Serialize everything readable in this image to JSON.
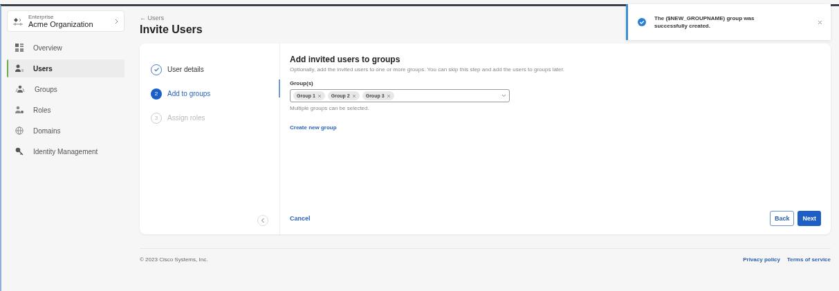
{
  "org": {
    "label": "Enterprise",
    "name": "Acme Organization"
  },
  "sidebar": {
    "items": [
      {
        "label": "Overview",
        "selected": false
      },
      {
        "label": "Users",
        "selected": true
      },
      {
        "label": "Groups",
        "selected": false
      },
      {
        "label": "Roles",
        "selected": false
      },
      {
        "label": "Domains",
        "selected": false
      },
      {
        "label": "Identity Management",
        "selected": false
      }
    ]
  },
  "header": {
    "back": "← Users",
    "title": "Invite Users"
  },
  "steps": [
    {
      "label": "User details",
      "kind": "done"
    },
    {
      "number": "2",
      "label": "Add to groups",
      "kind": "current"
    },
    {
      "number": "3",
      "label": "Assign roles",
      "kind": "pending"
    }
  ],
  "form": {
    "title": "Add invited users to groups",
    "description": "Optionally, add the invited users to one or more groups. You can skip this step and add the users to groups later.",
    "field_label": "Group(s)",
    "chips": [
      "Group 1",
      "Group 2",
      "Group 3"
    ],
    "help": "Multiple groups can be selected.",
    "link": "Create new group"
  },
  "actions": {
    "cancel": "Cancel",
    "back": "Back",
    "next": "Next"
  },
  "footer": {
    "copyright": "© 2023 Cisco Systems, Inc.",
    "links": [
      "Privacy policy",
      "Terms of service"
    ]
  },
  "toast": {
    "message": "The ($NEW_GROUPNAME) group was successfully created."
  }
}
